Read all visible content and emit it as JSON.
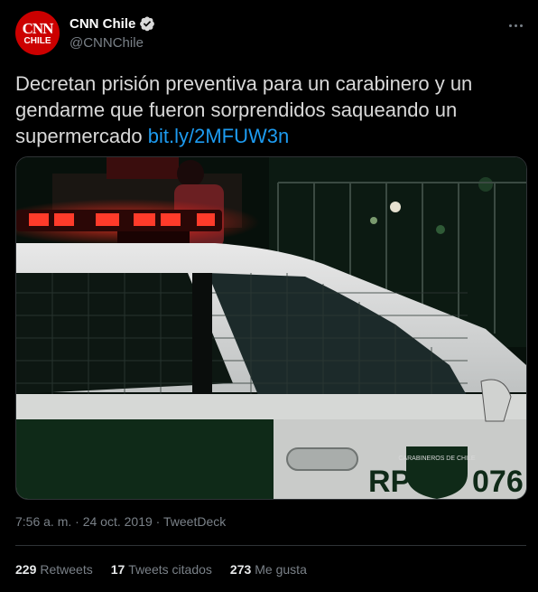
{
  "author": {
    "avatar_top": "CNN",
    "avatar_bottom": "CHILE",
    "name": "CNN Chile",
    "handle": "@CNNChile",
    "brand_color": "#cc0000"
  },
  "tweet": {
    "text": "Decretan prisión preventiva para un carabinero y un gendarme que fueron sorprendidos saqueando un supermercado ",
    "link": "bit.ly/2MFUW3n",
    "link_color": "#1d9bf0"
  },
  "media": {
    "car_plate_left": "RP",
    "car_plate_right": "076",
    "badge_text": "CARABINEROS DE CHILE"
  },
  "meta": {
    "time": "7:56 a. m.",
    "separator": "·",
    "date": "24 oct. 2019",
    "source": "TweetDeck"
  },
  "stats": [
    {
      "count": "229",
      "label": "Retweets"
    },
    {
      "count": "17",
      "label": "Tweets citados"
    },
    {
      "count": "273",
      "label": "Me gusta"
    }
  ],
  "icons": {
    "verified": "verified-badge-icon",
    "more": "more-options-icon"
  }
}
